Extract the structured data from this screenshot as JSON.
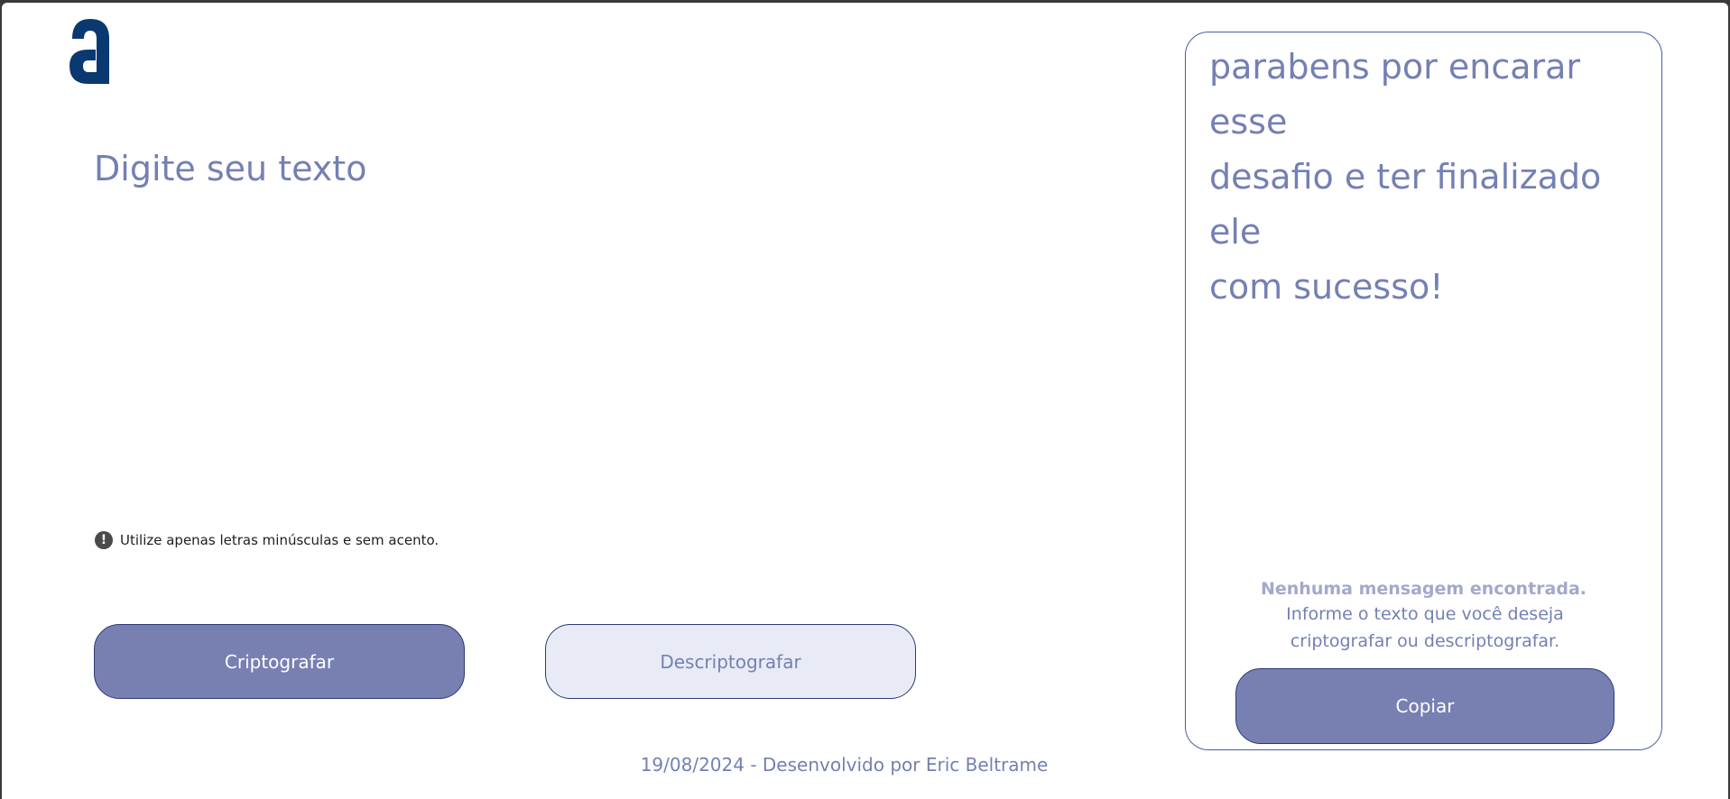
{
  "logo": {
    "icon": "alura-logo-icon",
    "color": "#0a3871"
  },
  "input": {
    "placeholder": "Digite seu texto",
    "value": ""
  },
  "hint": {
    "icon": "exclamation-circle-icon",
    "text": "Utilize apenas letras minúsculas e sem acento."
  },
  "buttons": {
    "encrypt_label": "Criptografar",
    "decrypt_label": "Descriptografar",
    "copy_label": "Copiar"
  },
  "output": {
    "text": "parabens por encarar esse\ndesafio e ter finalizado ele\ncom sucesso!",
    "empty_title": "Nenhuma mensagem encontrada.",
    "empty_description": "Informe o texto que você deseja criptografar ou descriptografar."
  },
  "footer": {
    "text": "19/08/2024 - Desenvolvido por Eric Beltrame"
  },
  "colors": {
    "primary": "#7880b2",
    "primary_text": "#7480b3",
    "border": "#2b3a78",
    "secondary_bg": "#e8ebf6",
    "muted": "#a2a9cc"
  }
}
